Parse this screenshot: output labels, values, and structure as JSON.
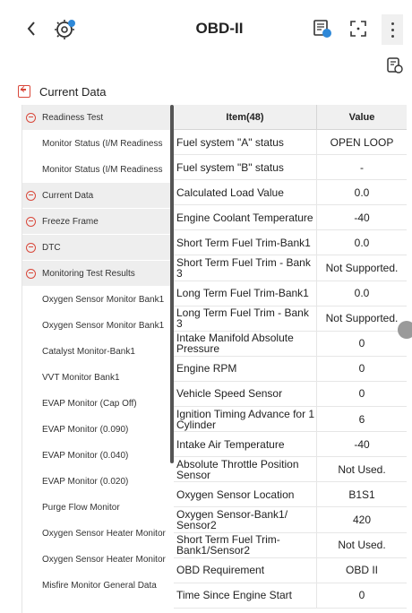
{
  "header": {
    "title": "OBD-II",
    "icons": {
      "back": "chevron-left-icon",
      "obd": "obd-connector-icon",
      "report": "report-icon",
      "fullscreen": "fullscreen-icon",
      "more": "more-vertical-icon",
      "sub": "export-icon"
    }
  },
  "section": {
    "title": "Current Data",
    "icon": "collapse-icon"
  },
  "tree": [
    {
      "label": "Readiness Test",
      "type": "parent"
    },
    {
      "label": "Monitor Status (I/M Readiness",
      "type": "child"
    },
    {
      "label": "Monitor Status (I/M Readiness",
      "type": "child"
    },
    {
      "label": "Current Data",
      "type": "parent"
    },
    {
      "label": "Freeze Frame",
      "type": "parent"
    },
    {
      "label": "DTC",
      "type": "parent"
    },
    {
      "label": "Monitoring Test Results",
      "type": "parent"
    },
    {
      "label": "Oxygen Sensor Monitor Bank1",
      "type": "child"
    },
    {
      "label": "Oxygen Sensor Monitor Bank1",
      "type": "child"
    },
    {
      "label": "Catalyst Monitor-Bank1",
      "type": "child"
    },
    {
      "label": "VVT Monitor Bank1",
      "type": "child"
    },
    {
      "label": "EVAP Monitor (Cap Off)",
      "type": "child"
    },
    {
      "label": "EVAP Monitor (0.090)",
      "type": "child"
    },
    {
      "label": "EVAP Monitor (0.040)",
      "type": "child"
    },
    {
      "label": "EVAP Monitor (0.020)",
      "type": "child"
    },
    {
      "label": "Purge Flow Monitor",
      "type": "child"
    },
    {
      "label": "Oxygen Sensor Heater Monitor",
      "type": "child"
    },
    {
      "label": "Oxygen Sensor Heater Monitor",
      "type": "child"
    },
    {
      "label": "Misfire Monitor General Data",
      "type": "child"
    }
  ],
  "table": {
    "columns": {
      "item": "Item(48)",
      "value": "Value"
    },
    "rows": [
      {
        "item": "Fuel system \"A\" status",
        "value": "OPEN LOOP"
      },
      {
        "item": "Fuel system \"B\" status",
        "value": "-"
      },
      {
        "item": "Calculated Load Value",
        "value": "0.0"
      },
      {
        "item": "Engine Coolant Temperature",
        "value": "-40"
      },
      {
        "item": "Short Term Fuel Trim-Bank1",
        "value": "0.0"
      },
      {
        "item": "Short Term Fuel Trim - Bank 3",
        "value": "Not Supported."
      },
      {
        "item": "Long Term Fuel Trim-Bank1",
        "value": "0.0"
      },
      {
        "item": "Long Term Fuel Trim - Bank 3",
        "value": "Not Supported."
      },
      {
        "item": "Intake Manifold Absolute Pressure",
        "value": "0"
      },
      {
        "item": "Engine RPM",
        "value": "0"
      },
      {
        "item": "Vehicle Speed Sensor",
        "value": "0"
      },
      {
        "item": "Ignition Timing Advance for 1 Cylinder",
        "value": "6"
      },
      {
        "item": "Intake Air Temperature",
        "value": "-40"
      },
      {
        "item": "Absolute Throttle Position Sensor",
        "value": "Not Used."
      },
      {
        "item": "Oxygen Sensor Location",
        "value": "B1S1"
      },
      {
        "item": "Oxygen Sensor-Bank1/ Sensor2",
        "value": "420"
      },
      {
        "item": "Short Term Fuel Trim-Bank1/Sensor2",
        "value": "Not Used."
      },
      {
        "item": "OBD Requirement",
        "value": "OBD II"
      },
      {
        "item": "Time Since Engine Start",
        "value": "0"
      }
    ]
  },
  "colors": {
    "accent": "#d9483b",
    "panel_gray": "#eeeeee",
    "header_gray": "#f0f0f0"
  }
}
